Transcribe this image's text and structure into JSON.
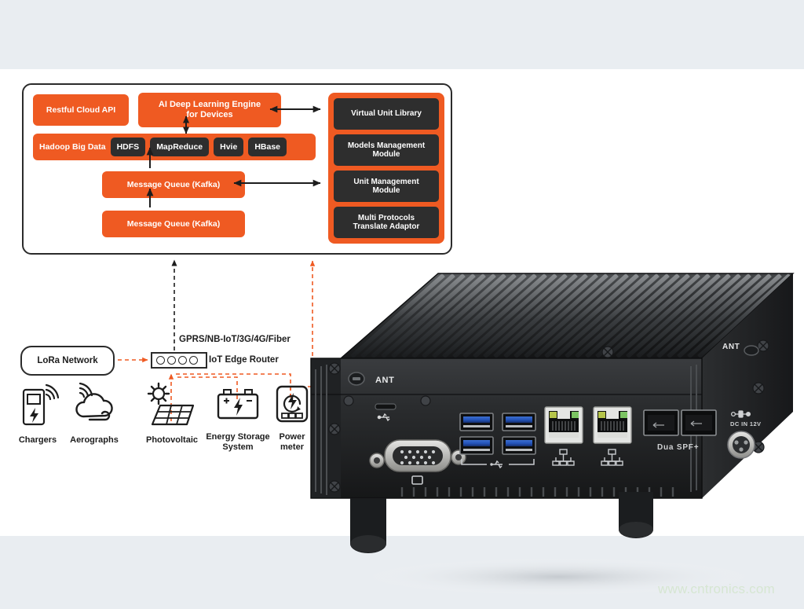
{
  "page": {
    "background": "#e9edf1",
    "canvas_background": "#ffffff",
    "accent_orange": "#ef5a22",
    "chip_dark": "#2e2e2e",
    "watermark": "www.cntronics.com",
    "watermark_color": "#d6e6d2"
  },
  "diagram": {
    "platform": {
      "restful_cloud_api": "Restful Cloud API",
      "ai_engine": "AI Deep Learning Engine for Devices",
      "ai_engine_line1": "AI Deep Learning Engine",
      "ai_engine_line2": "for Devices",
      "hadoop_label": "Hadoop Big Data",
      "hadoop_chips": [
        {
          "label": "HDFS"
        },
        {
          "label": "MapReduce"
        },
        {
          "label": "Hvie"
        },
        {
          "label": "HBase"
        }
      ],
      "message_queue_upper": "Message Queue (Kafka)",
      "message_queue_lower": "Message Queue (Kafka)",
      "right_modules": [
        {
          "label": "Virtual Unit Library"
        },
        {
          "label": "Models Management Module",
          "line1": "Models Management",
          "line2": "Module"
        },
        {
          "label": "Unit Management Module",
          "line1": "Unit Management",
          "line2": "Module"
        },
        {
          "label": "Multi Protocols Translate Adaptor",
          "line1": "Multi Protocols",
          "line2": "Translate Adaptor"
        }
      ]
    },
    "network": {
      "uplink_label": "GPRS/NB-IoT/3G/4G/Fiber",
      "lora_network": "LoRa Network",
      "edge_router": "IoT Edge Router",
      "router_port_count": 4
    },
    "devices": [
      {
        "icon": "ev-charger-icon",
        "label": "Chargers"
      },
      {
        "icon": "weather-cloud-wind-icon",
        "label": "Aerographs"
      },
      {
        "icon": "solar-panel-icon",
        "label": "Photovoltaic"
      },
      {
        "icon": "battery-storage-icon",
        "label": "Energy Storage System",
        "line1": "Energy Storage",
        "line2": "System"
      },
      {
        "icon": "power-meter-icon",
        "label": "Power meter",
        "line1": "Power",
        "line2": "meter"
      }
    ]
  },
  "device_photo": {
    "description": "Fanless industrial edge computer, finned heatsink top, front I/O panel",
    "port_labels": {
      "antenna_front": "ANT",
      "antenna_side": "ANT",
      "sfp": "Dua SPF+",
      "power": "DC IN 12V"
    },
    "ports": {
      "vga": "VGA",
      "micro_usb": "micro-USB",
      "usb3_count": 4,
      "rj45_count": 2,
      "sfp_count": 2
    }
  }
}
